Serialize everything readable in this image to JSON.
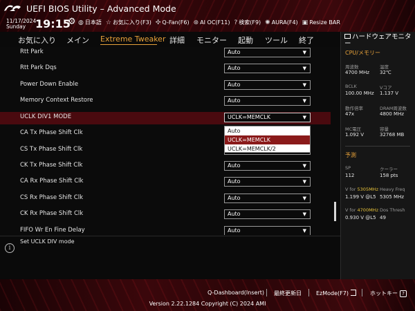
{
  "app": {
    "title": "UEFI BIOS Utility – Advanced Mode",
    "date_line1": "11/17/2024",
    "date_line2": "Sunday",
    "time": "19:15"
  },
  "toolbar": [
    {
      "icon": "globe-icon",
      "label": "日本語"
    },
    {
      "icon": "star-icon",
      "label": "お気に入り(F3)"
    },
    {
      "icon": "fan-icon",
      "label": "Q-Fan(F6)"
    },
    {
      "icon": "ai-oc-icon",
      "label": "AI OC(F11)"
    },
    {
      "icon": "search-icon",
      "label": "検索(F9)"
    },
    {
      "icon": "aura-icon",
      "label": "AURA(F4)"
    },
    {
      "icon": "resize-bar-icon",
      "label": "Resize BAR"
    }
  ],
  "menu": [
    {
      "label": "お気に入り",
      "active": false
    },
    {
      "label": "メイン",
      "active": false
    },
    {
      "label": "Extreme Tweaker",
      "active": true
    },
    {
      "label": "詳細",
      "active": false
    },
    {
      "label": "モニター",
      "active": false
    },
    {
      "label": "起動",
      "active": false
    },
    {
      "label": "ツール",
      "active": false
    },
    {
      "label": "終了",
      "active": false
    }
  ],
  "settings": [
    {
      "label": "Rtt Park",
      "value": "Auto"
    },
    {
      "label": "Rtt Park Dqs",
      "value": "Auto"
    },
    {
      "label": "Power Down Enable",
      "value": "Auto"
    },
    {
      "label": "Memory Context Restore",
      "value": "Auto"
    },
    {
      "label": "UCLK DIV1 MODE",
      "value": "UCLK=MEMCLK"
    },
    {
      "label": "CA Tx Phase Shift Clk",
      "value": ""
    },
    {
      "label": "CS Tx Phase Shift Clk",
      "value": ""
    },
    {
      "label": "CK Tx Phase Shift Clk",
      "value": "Auto"
    },
    {
      "label": "CA Rx Phase Shift Clk",
      "value": "Auto"
    },
    {
      "label": "CS Rx Phase Shift Clk",
      "value": "Auto"
    },
    {
      "label": "CK Rx Phase Shift Clk",
      "value": "Auto"
    },
    {
      "label": "FIFO Wr En Fine Delay",
      "value": "Auto"
    }
  ],
  "dropdown": {
    "options": [
      "Auto",
      "UCLK=MEMCLK",
      "UCLK=MEMCLK/2"
    ],
    "selected_index": 1
  },
  "help": {
    "text": "Set UCLK DIV mode"
  },
  "hw_monitor": {
    "title": "ハードウェアモニター",
    "cpu_memory": {
      "section": "CPU/メモリー",
      "items": [
        {
          "label": "周波数",
          "value": "4700 MHz"
        },
        {
          "label": "温度",
          "value": "32℃"
        },
        {
          "label": "BCLK",
          "value": "100.00 MHz"
        },
        {
          "label": "Vコア",
          "value": "1.137 V"
        },
        {
          "label": "動作倍率",
          "value": "47x"
        },
        {
          "label": "DRAM周波数",
          "value": "4800 MHz"
        },
        {
          "label": "MC電圧",
          "value": "1.092 V"
        },
        {
          "label": "容量",
          "value": "32768 MB"
        }
      ]
    },
    "prediction": {
      "section": "予測",
      "sp_label": "SP",
      "sp_value": "112",
      "cooler_label": "クーラー",
      "cooler_value": "158 pts",
      "v_for_1_prefix": "V for ",
      "v_for_1_freq": "5305MHz",
      "v_for_1_value": "1.199 V @L5",
      "heavy_freq_label": "Heavy Freq",
      "heavy_freq_value": "5305 MHz",
      "v_for_2_prefix": "V for ",
      "v_for_2_freq": "4700MHz",
      "v_for_2_value": "0.930 V @L5",
      "dos_thresh_label": "Dos Thresh",
      "dos_thresh_value": "49"
    }
  },
  "footer": {
    "q_dashboard": "Q-Dashboard(Insert)",
    "last_modified": "最終更新日",
    "ez_mode": "EzMode(F7)",
    "hotkeys": "ホットキー",
    "hotkeys_icon": "?",
    "copyright": "Version 2.22.1284 Copyright (C) 2024 AMI"
  },
  "colors": {
    "accent": "#e8a23a",
    "highlight_row": "#4a0a0f",
    "header_red": "#3a070b",
    "dropdown_selected": "#8a1a1a"
  }
}
